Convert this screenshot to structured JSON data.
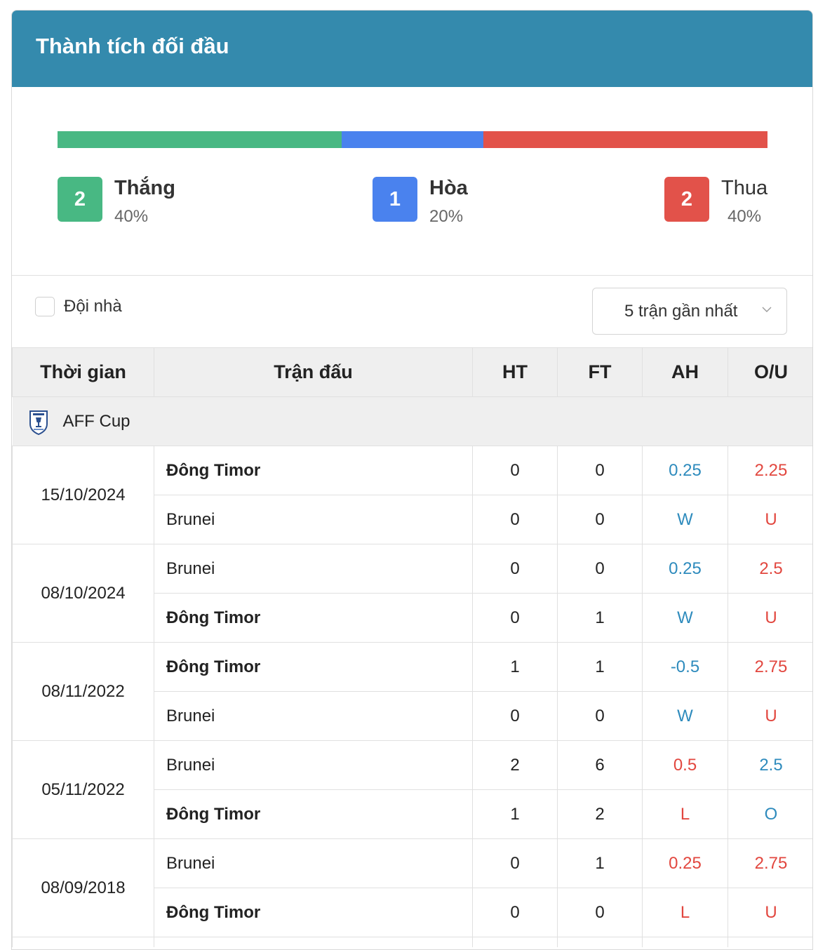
{
  "header": {
    "title": "Thành tích đối đầu"
  },
  "summary": {
    "ratio": {
      "win": 0.4,
      "draw": 0.2,
      "loss": 0.4
    },
    "colors": {
      "win": "#48b883",
      "draw": "#4a82ee",
      "loss": "#e2524a"
    },
    "win": {
      "count": "2",
      "label": "Thắng",
      "percent": "40%"
    },
    "draw": {
      "count": "1",
      "label": "Hòa",
      "percent": "20%"
    },
    "loss": {
      "count": "2",
      "label": "Thua",
      "percent": "40%"
    }
  },
  "filters": {
    "home_checkbox_label": "Đội nhà",
    "range_select": "5 trận gần nhất"
  },
  "table": {
    "headers": {
      "time": "Thời gian",
      "match": "Trận đấu",
      "ht": "HT",
      "ft": "FT",
      "ah": "AH",
      "ou": "O/U"
    },
    "league": {
      "name": "AFF Cup",
      "icon": "aff-cup-logo-icon"
    },
    "matches": [
      {
        "date": "15/10/2024",
        "home": {
          "team": "Đông Timor",
          "ht": "0",
          "ft": "0",
          "ah": "0.25",
          "ou": "2.25"
        },
        "away": {
          "team": "Brunei",
          "ht": "0",
          "ft": "0",
          "ah": "W",
          "ou": "U"
        }
      },
      {
        "date": "08/10/2024",
        "home": {
          "team": "Brunei",
          "ht": "0",
          "ft": "0",
          "ah": "0.25",
          "ou": "2.5"
        },
        "away": {
          "team": "Đông Timor",
          "ht": "0",
          "ft": "1",
          "ah": "W",
          "ou": "U"
        }
      },
      {
        "date": "08/11/2022",
        "home": {
          "team": "Đông Timor",
          "ht": "1",
          "ft": "1",
          "ah": "-0.5",
          "ou": "2.75"
        },
        "away": {
          "team": "Brunei",
          "ht": "0",
          "ft": "0",
          "ah": "W",
          "ou": "U"
        }
      },
      {
        "date": "05/11/2022",
        "home": {
          "team": "Brunei",
          "ht": "2",
          "ft": "6",
          "ah": "0.5",
          "ou": "2.5"
        },
        "away": {
          "team": "Đông Timor",
          "ht": "1",
          "ft": "2",
          "ah": "L",
          "ou": "O"
        }
      },
      {
        "date": "08/09/2018",
        "home": {
          "team": "Brunei",
          "ht": "0",
          "ft": "1",
          "ah": "0.25",
          "ou": "2.75"
        },
        "away": {
          "team": "Đông Timor",
          "ht": "0",
          "ft": "0",
          "ah": "L",
          "ou": "U"
        }
      }
    ]
  }
}
